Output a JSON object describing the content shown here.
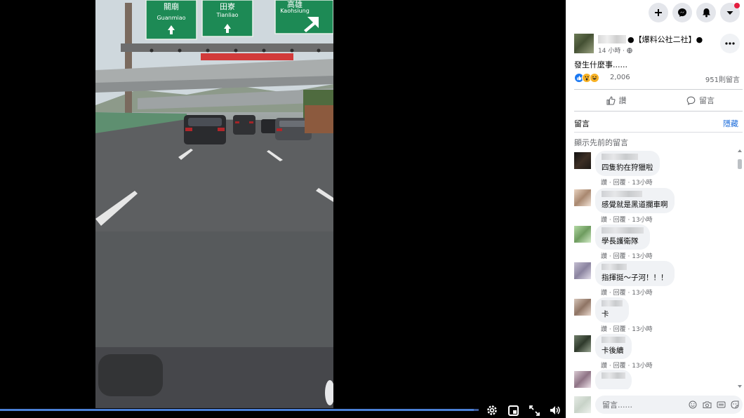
{
  "video": {
    "signs": [
      {
        "zh": "關廟",
        "en": "Guanmiao"
      },
      {
        "zh": "田寮",
        "en": "Tianliao"
      },
      {
        "zh": "高雄",
        "en": "Kaohsiung"
      }
    ],
    "progress_fraction": 0.99
  },
  "post": {
    "author": "●【爆料公社二社】●",
    "time": "14 小時 · ",
    "text": "發生什麼事......",
    "reaction_count": "2,006",
    "comment_count": "951則留言"
  },
  "actions": {
    "like_label": "讚",
    "comment_label": "留言"
  },
  "comments_section": {
    "title": "留言",
    "hide_label": "隱藏",
    "show_previous": "顯示先前的留言"
  },
  "comments": [
    {
      "text": "四隻豹在狩獵啦",
      "like": "讚",
      "reply": "回覆",
      "time": "13小時"
    },
    {
      "text": "感覺就是黑道攔車啊",
      "like": "讚",
      "reply": "回覆",
      "time": "13小時"
    },
    {
      "text": "學長護衛隊",
      "like": "讚",
      "reply": "回覆",
      "time": "13小時"
    },
    {
      "text": "指揮挺～子河！！！",
      "like": "讚",
      "reply": "回覆",
      "time": "13小時"
    },
    {
      "text": "卡",
      "like": "讚",
      "reply": "回覆",
      "time": "13小時"
    },
    {
      "text": "卡後續",
      "like": "讚",
      "reply": "回覆",
      "time": "13小時"
    },
    {
      "text": "",
      "like": "",
      "reply": "",
      "time": ""
    }
  ],
  "composer": {
    "placeholder": "留言......"
  },
  "colors": {
    "accent": "#216fdb",
    "progress": "#3b5998",
    "sign_green": "#1d8a55"
  }
}
